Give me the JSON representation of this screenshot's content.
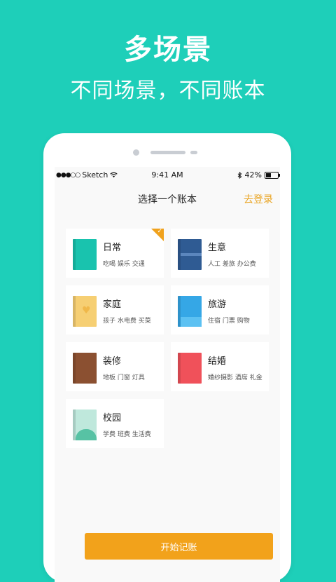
{
  "headline": "多场景",
  "subline": "不同场景，不同账本",
  "status_bar": {
    "carrier": "Sketch",
    "time": "9:41 AM",
    "battery": "42%",
    "battery_level": 0.42
  },
  "nav": {
    "title": "选择一个账本",
    "login": "去登录"
  },
  "books": [
    {
      "title": "日常",
      "desc": "吃喝 娱乐 交通",
      "color": "#19c3ae",
      "selected": true
    },
    {
      "title": "生意",
      "desc": "人工 差旅 办公费",
      "color": "#2f5b93",
      "selected": false
    },
    {
      "title": "家庭",
      "desc": "孩子 水电费 买菜",
      "color": "#f6cf73",
      "selected": false
    },
    {
      "title": "旅游",
      "desc": "住宿 门票 购物",
      "color": "#35a7e6",
      "selected": false
    },
    {
      "title": "装修",
      "desc": "地板 门窗 灯具",
      "color": "#8b5031",
      "selected": false
    },
    {
      "title": "结婚",
      "desc": "婚纱摄影 酒席 礼金",
      "color": "#f0515a",
      "selected": false
    },
    {
      "title": "校园",
      "desc": "学费 班费 生活费",
      "color": "#bfe8dc",
      "selected": false
    }
  ],
  "start_button": "开始记账",
  "colors": {
    "background": "#1ecfb9",
    "accent": "#f2a21b"
  }
}
